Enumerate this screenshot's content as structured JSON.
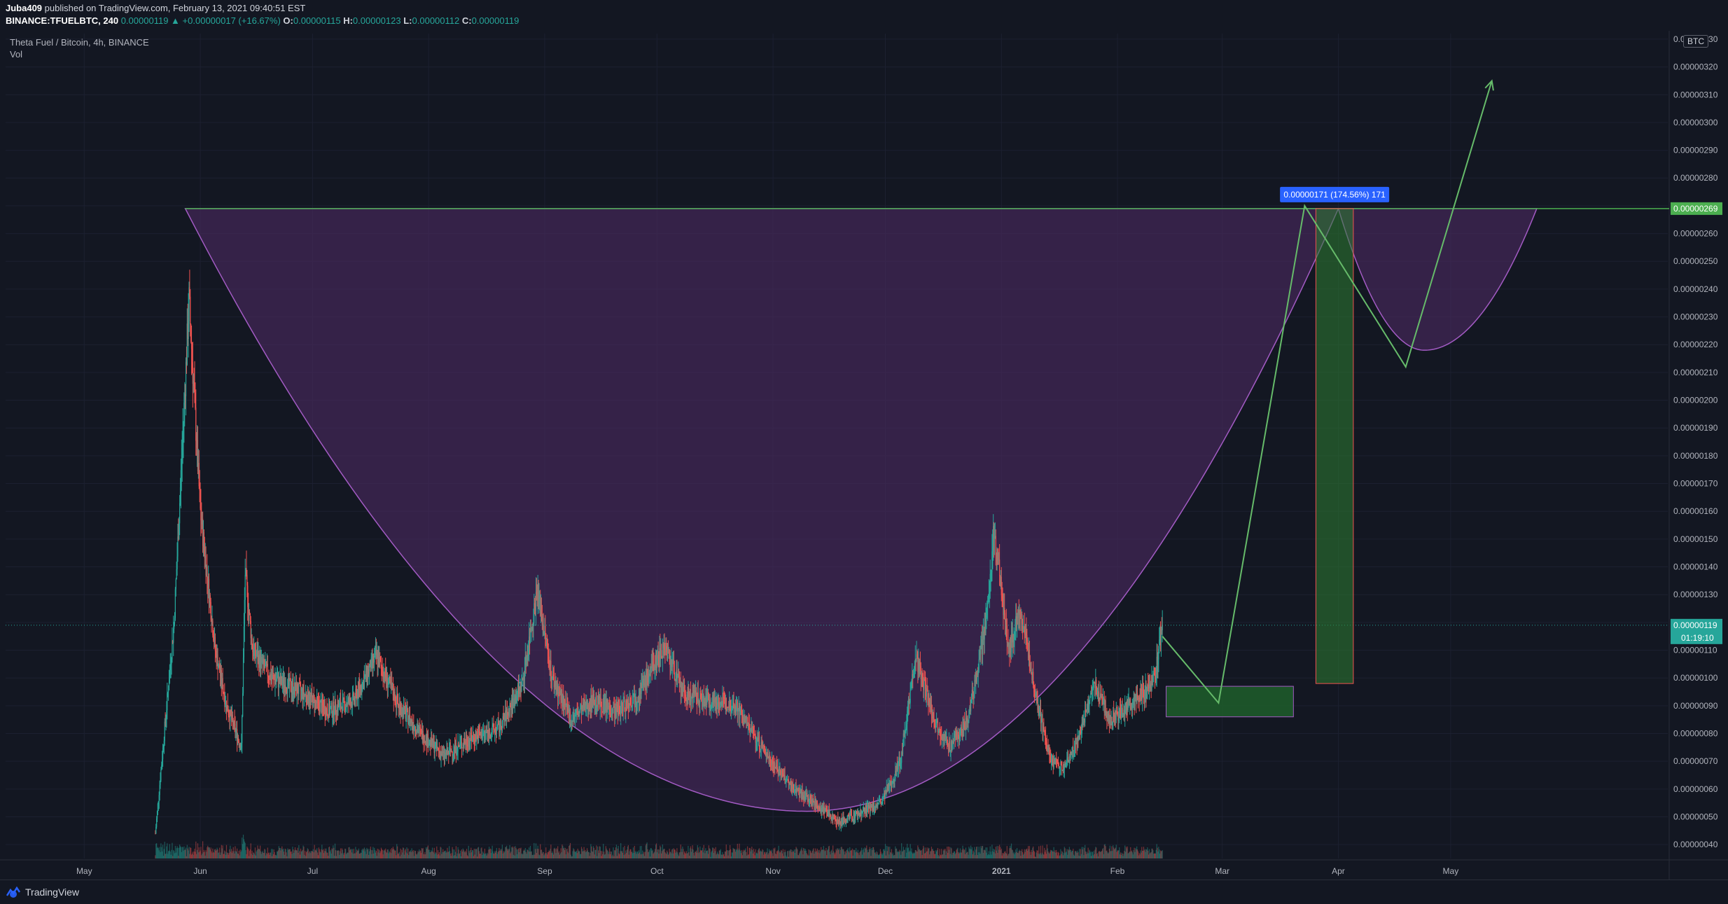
{
  "header": {
    "author": "Juba409",
    "publish_text": "published on TradingView.com, February 13, 2021 09:40:51 EST",
    "symbol_text": "BINANCE:TFUELBTC, 240",
    "last_price": "0.00000119",
    "change": "+0.00000017 (+16.67%)",
    "o_label": "O:",
    "o_value": "0.00000115",
    "h_label": "H:",
    "h_value": "0.00000123",
    "l_label": "L:",
    "l_value": "0.00000112",
    "c_label": "C:",
    "c_value": "0.00000119"
  },
  "legend": {
    "series_title": "Theta Fuel / Bitcoin, 4h, BINANCE",
    "volume_label": "Vol"
  },
  "currency_button": "BTC",
  "footer": {
    "brand": "TradingView"
  },
  "colors": {
    "background": "#131722",
    "up_candle": "#26a69a",
    "down_candle": "#ef5350",
    "cup_fill": "#4a2a5f",
    "cup_stroke": "#a35bc4",
    "resistance_line": "#4caf50",
    "projection_line": "#66bb6a",
    "target_box": "#1e5a2a",
    "measure_tag": "#2962ff"
  },
  "chart_data": {
    "type": "candlestick",
    "symbol": "BINANCE:TFUELBTC",
    "timeframe": "4h",
    "ylim": [
      3.5e-07,
      3.32e-06
    ],
    "y_ticks": [
      "0.00000040",
      "0.00000050",
      "0.00000060",
      "0.00000070",
      "0.00000080",
      "0.00000090",
      "0.00000100",
      "0.00000110",
      "0.00000120",
      "0.00000130",
      "0.00000140",
      "0.00000150",
      "0.00000160",
      "0.00000170",
      "0.00000180",
      "0.00000190",
      "0.00000200",
      "0.00000210",
      "0.00000220",
      "0.00000230",
      "0.00000240",
      "0.00000250",
      "0.00000260",
      "0.00000270",
      "0.00000280",
      "0.00000290",
      "0.00000300",
      "0.00000310",
      "0.00000320",
      "0.00000330"
    ],
    "y_tick_labels": [
      "0.00000040",
      "0.00000050",
      "0.00000060",
      "0.00000070",
      "0.00000080",
      "0.00000090",
      "0.00000100",
      "0.00000110",
      "0.00000120",
      "0.00000130",
      "0.00000140",
      "0.00000150",
      "0.00000160",
      "0.00000170",
      "0.00000180",
      "0.00000190",
      "0.00000200",
      "0.00000210",
      "0.00000220",
      "0.00000230",
      "0.00000240",
      "0.00000250",
      "0.00000260",
      "",
      "0.00000280",
      "0.00000290",
      "0.00000300",
      "0.00000310",
      "0.00000320",
      "0.00000330"
    ],
    "x_axis": {
      "start_day": "2020-04-10",
      "end_day": "2021-06-28",
      "ticks": [
        {
          "label": "May",
          "day": "2020-05-01"
        },
        {
          "label": "Jun",
          "day": "2020-06-01"
        },
        {
          "label": "Jul",
          "day": "2020-07-01"
        },
        {
          "label": "Aug",
          "day": "2020-08-01"
        },
        {
          "label": "Sep",
          "day": "2020-09-01"
        },
        {
          "label": "Oct",
          "day": "2020-10-01"
        },
        {
          "label": "Nov",
          "day": "2020-11-01"
        },
        {
          "label": "Dec",
          "day": "2020-12-01"
        },
        {
          "label": "2021",
          "day": "2021-01-01",
          "bold": true
        },
        {
          "label": "Feb",
          "day": "2021-02-01"
        },
        {
          "label": "Mar",
          "day": "2021-03-01"
        },
        {
          "label": "Apr",
          "day": "2021-04-01"
        },
        {
          "label": "May",
          "day": "2021-05-01"
        }
      ]
    },
    "price_path": [
      [
        "2020-05-20",
        4.4e-07
      ],
      [
        "2020-05-25",
        1.2e-06
      ],
      [
        "2020-05-29",
        2.36e-06
      ],
      [
        "2020-06-01",
        1.6e-06
      ],
      [
        "2020-06-05",
        1.1e-06
      ],
      [
        "2020-06-08",
        9e-07
      ],
      [
        "2020-06-12",
        7.5e-07
      ],
      [
        "2020-06-13",
        1.38e-06
      ],
      [
        "2020-06-15",
        1.1e-06
      ],
      [
        "2020-06-20",
        1e-06
      ],
      [
        "2020-06-28",
        9.5e-07
      ],
      [
        "2020-07-05",
        8.8e-07
      ],
      [
        "2020-07-12",
        9.2e-07
      ],
      [
        "2020-07-18",
        1.08e-06
      ],
      [
        "2020-07-24",
        9e-07
      ],
      [
        "2020-07-30",
        8e-07
      ],
      [
        "2020-08-05",
        7.2e-07
      ],
      [
        "2020-08-12",
        7.8e-07
      ],
      [
        "2020-08-20",
        8.2e-07
      ],
      [
        "2020-08-26",
        9.8e-07
      ],
      [
        "2020-08-30",
        1.32e-06
      ],
      [
        "2020-09-03",
        1e-06
      ],
      [
        "2020-09-08",
        8.5e-07
      ],
      [
        "2020-09-14",
        9.2e-07
      ],
      [
        "2020-09-20",
        8.8e-07
      ],
      [
        "2020-09-26",
        9.4e-07
      ],
      [
        "2020-10-03",
        1.12e-06
      ],
      [
        "2020-10-08",
        9.4e-07
      ],
      [
        "2020-10-15",
        9.2e-07
      ],
      [
        "2020-10-22",
        9e-07
      ],
      [
        "2020-10-29",
        7.5e-07
      ],
      [
        "2020-11-05",
        6.2e-07
      ],
      [
        "2020-11-12",
        5.5e-07
      ],
      [
        "2020-11-19",
        4.8e-07
      ],
      [
        "2020-11-25",
        5.2e-07
      ],
      [
        "2020-11-30",
        5.5e-07
      ],
      [
        "2020-12-05",
        7e-07
      ],
      [
        "2020-12-09",
        1.08e-06
      ],
      [
        "2020-12-14",
        8.5e-07
      ],
      [
        "2020-12-18",
        7.5e-07
      ],
      [
        "2020-12-23",
        8.5e-07
      ],
      [
        "2020-12-28",
        1.2e-06
      ],
      [
        "2020-12-30",
        1.53e-06
      ],
      [
        "2021-01-03",
        1.1e-06
      ],
      [
        "2021-01-06",
        1.25e-06
      ],
      [
        "2021-01-10",
        9.5e-07
      ],
      [
        "2021-01-14",
        7e-07
      ],
      [
        "2021-01-18",
        6.8e-07
      ],
      [
        "2021-01-22",
        8e-07
      ],
      [
        "2021-01-26",
        9.8e-07
      ],
      [
        "2021-01-30",
        8.5e-07
      ],
      [
        "2021-02-04",
        9e-07
      ],
      [
        "2021-02-08",
        9.5e-07
      ],
      [
        "2021-02-11",
        1e-06
      ],
      [
        "2021-02-13",
        1.19e-06
      ]
    ],
    "resistance_level": {
      "value": 2.69e-06,
      "label": "0.00000269",
      "from": "2020-05-28"
    },
    "last_price_marker": {
      "value": 1.19e-06,
      "label": "0.00000119",
      "countdown": "01:19:10"
    },
    "cup": {
      "left": [
        "2020-05-28",
        2.69e-06
      ],
      "bottom": [
        "2020-11-10",
        5.2e-07
      ],
      "right": [
        "2021-04-01",
        2.69e-06
      ]
    },
    "handle": {
      "left": [
        "2021-04-01",
        2.69e-06
      ],
      "bottom": [
        "2021-04-24",
        2.18e-06
      ],
      "right": [
        "2021-05-24",
        2.69e-06
      ]
    },
    "projection_path": [
      [
        "2021-02-13",
        1.15e-06
      ],
      [
        "2021-02-28",
        9.1e-07
      ],
      [
        "2021-03-23",
        2.7e-06
      ],
      [
        "2021-04-19",
        2.12e-06
      ],
      [
        "2021-05-12",
        3.15e-06
      ]
    ],
    "support_box": {
      "from": "2021-02-14",
      "to": "2021-03-20",
      "low": 8.6e-07,
      "high": 9.7e-07
    },
    "measure_box": {
      "from": "2021-03-26",
      "to": "2021-04-05",
      "low": 9.8e-07,
      "high": 2.69e-06,
      "label": "0.00000171 (174.56%) 171"
    }
  }
}
